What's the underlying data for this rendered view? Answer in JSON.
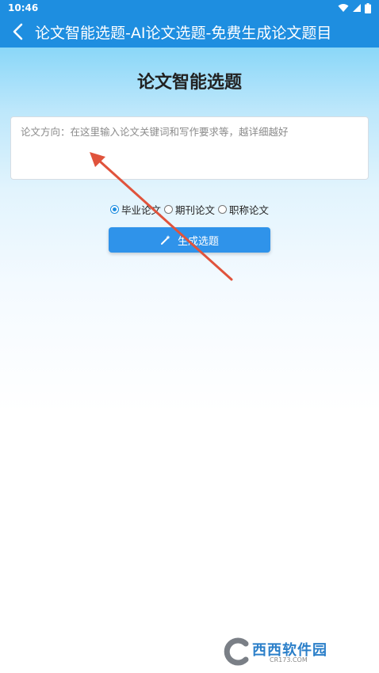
{
  "status_bar": {
    "time": "10:46"
  },
  "header": {
    "title": "论文智能选题-AI论文选题-免费生成论文题目"
  },
  "main": {
    "title": "论文智能选题",
    "input": {
      "placeholder": "论文方向：在这里输入论文关键词和写作要求等，越详细越好",
      "value": ""
    },
    "paper_types": [
      {
        "label": "毕业论文",
        "selected": true
      },
      {
        "label": "期刊论文",
        "selected": false
      },
      {
        "label": "职称论文",
        "selected": false
      }
    ],
    "generate_label": "生成选题"
  },
  "watermark": {
    "logo_text": "西西软件园",
    "sub_text": "CR173.COM"
  },
  "colors": {
    "header_bg": "#1e8ee0",
    "accent": "#2f93ea",
    "annotation_arrow": "#e0533c"
  }
}
